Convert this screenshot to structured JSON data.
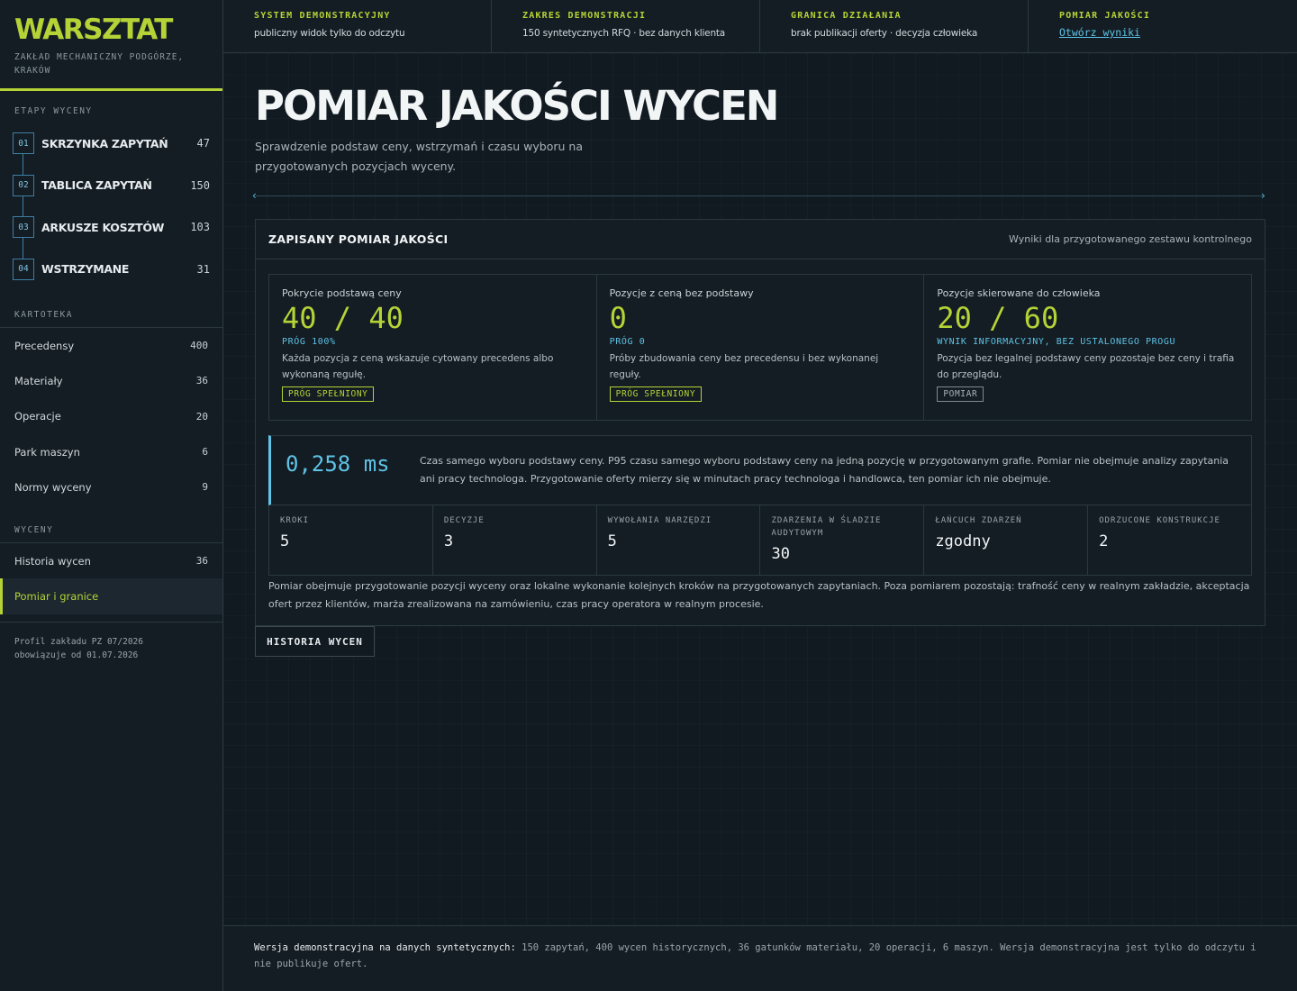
{
  "brand": {
    "title": "WARSZTAT",
    "subtitle": "ZAKŁAD MECHANICZNY PODGÓRZE, KRAKÓW"
  },
  "sidebar": {
    "stages_label": "ETAPY WYCENY",
    "stages": [
      {
        "num": "01",
        "label": "SKRZYNKA ZAPYTAŃ",
        "count": "47"
      },
      {
        "num": "02",
        "label": "TABLICA ZAPYTAŃ",
        "count": "150"
      },
      {
        "num": "03",
        "label": "ARKUSZE KOSZTÓW",
        "count": "103"
      },
      {
        "num": "04",
        "label": "WSTRZYMANE",
        "count": "31"
      }
    ],
    "catalog_label": "KARTOTEKA",
    "catalog": [
      {
        "label": "Precedensy",
        "count": "400"
      },
      {
        "label": "Materiały",
        "count": "36"
      },
      {
        "label": "Operacje",
        "count": "20"
      },
      {
        "label": "Park maszyn",
        "count": "6"
      },
      {
        "label": "Normy wyceny",
        "count": "9"
      }
    ],
    "quotes_label": "WYCENY",
    "quotes": [
      {
        "label": "Historia wycen",
        "count": "36"
      },
      {
        "label": "Pomiar i granice",
        "count": ""
      }
    ],
    "profile_line1": "Profil zakładu PZ 07/2026",
    "profile_line2": "obowiązuje od 01.07.2026"
  },
  "topbar": [
    {
      "label": "SYSTEM DEMONSTRACYJNY",
      "value": "publiczny widok tylko do odczytu"
    },
    {
      "label": "ZAKRES DEMONSTRACJI",
      "value": "150 syntetycznych RFQ · bez danych klienta"
    },
    {
      "label": "GRANICA DZIAŁANIA",
      "value": "brak publikacji oferty · decyzja człowieka"
    },
    {
      "label": "POMIAR JAKOŚCI",
      "link": "Otwórz wyniki"
    }
  ],
  "main": {
    "title": "POMIAR JAKOŚCI WYCEN",
    "description": "Sprawdzenie podstaw ceny, wstrzymań i czasu wyboru na przygotowanych pozycjach wyceny.",
    "panel": {
      "title": "ZAPISANY POMIAR JAKOŚCI",
      "note": "Wyniki dla przygotowanego zestawu kontrolnego",
      "metrics": [
        {
          "label": "Pokrycie podstawą ceny",
          "value": "40 / 40",
          "threshold": "PRÓG 100%",
          "desc": "Każda pozycja z ceną wskazuje cytowany precedens albo wykonaną regułę.",
          "badge": "PRÓG SPEŁNIONY"
        },
        {
          "label": "Pozycje z ceną bez podstawy",
          "value": "0",
          "threshold": "PRÓG 0",
          "desc": "Próby zbudowania ceny bez precedensu i bez wykonanej reguły.",
          "badge": "PRÓG SPEŁNIONY"
        },
        {
          "label": "Pozycje skierowane do człowieka",
          "value": "20 / 60",
          "threshold": "WYNIK INFORMACYJNY, BEZ USTALONEGO PROGU",
          "desc": "Pozycja bez legalnej podstawy ceny pozostaje bez ceny i trafia do przeglądu.",
          "badge": "POMIAR"
        }
      ],
      "timing": {
        "value": "0,258 ms",
        "desc": "Czas samego wyboru podstawy ceny. P95 czasu samego wyboru podstawy ceny na jedną pozycję w przygotowanym grafie. Pomiar nie obejmuje analizy zapytania ani pracy technologa. Przygotowanie oferty mierzy się w minutach pracy technologa i handlowca, ten pomiar ich nie obejmuje."
      },
      "stats": [
        {
          "label": "KROKI",
          "value": "5"
        },
        {
          "label": "DECYZJE",
          "value": "3"
        },
        {
          "label": "WYWOŁANIA NARZĘDZI",
          "value": "5"
        },
        {
          "label": "ZDARZENIA W ŚLADZIE AUDYTOWYM",
          "value": "30"
        },
        {
          "label": "ŁAŃCUCH ZDARZEŃ",
          "value": "zgodny"
        },
        {
          "label": "ODRZUCONE KONSTRUKCJE",
          "value": "2"
        }
      ],
      "scope": "Pomiar obejmuje przygotowanie pozycji wyceny oraz lokalne wykonanie kolejnych kroków na przygotowanych zapytaniach. Poza pomiarem pozostają: trafność ceny w realnym zakładzie, akceptacja ofert przez klientów, marża zrealizowana na zamówieniu, czas pracy operatora w realnym procesie."
    },
    "history_button": "HISTORIA WYCEN"
  },
  "footer": {
    "lead": "Wersja demonstracyjna na danych syntetycznych:",
    "text": " 150 zapytań, 400 wycen historycznych, 36 gatunków materiału, 20 operacji, 6 maszyn. Wersja demonstracyjna jest tylko do odczytu i nie publikuje ofert."
  },
  "colors": {
    "accent": "#b5d336",
    "info": "#5ec3e6",
    "background": "#111a21"
  }
}
